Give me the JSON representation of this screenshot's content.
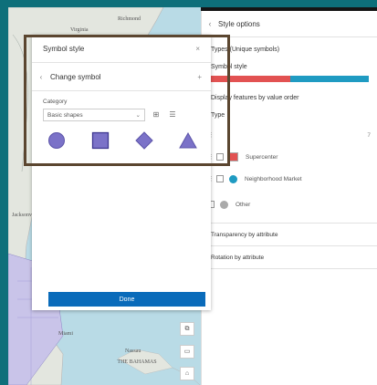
{
  "map": {
    "labels": {
      "virginia": "Virginia",
      "richmond": "Richmond",
      "jacksonville": "Jacksonville",
      "miami": "Miami",
      "nassau": "Nassau",
      "bahamas": "THE BAHAMAS"
    }
  },
  "style_panel": {
    "header": "Style options",
    "types": "Types (Unique symbols)",
    "symbol_style": "Symbol style",
    "display_order": "Display features by value order",
    "type_label": "Type",
    "count_value": "7",
    "rows": [
      {
        "label": "Supercenter",
        "swatch": "square",
        "color": "#e25252"
      },
      {
        "label": "Neighborhood Market",
        "swatch": "circle",
        "color": "#1f9bc2"
      },
      {
        "label": "Other",
        "swatch": "circle",
        "color": "#aaaaaa"
      }
    ],
    "transparency": "Transparency by attribute",
    "rotation": "Rotation by attribute"
  },
  "popup": {
    "title": "Symbol style",
    "close": "×",
    "change_symbol": "Change symbol",
    "add": "+",
    "category_label": "Category",
    "category_value": "Basic shapes",
    "shapes": [
      "circle",
      "square",
      "diamond",
      "triangle"
    ],
    "shape_color": "#7b72c8",
    "done": "Done"
  }
}
